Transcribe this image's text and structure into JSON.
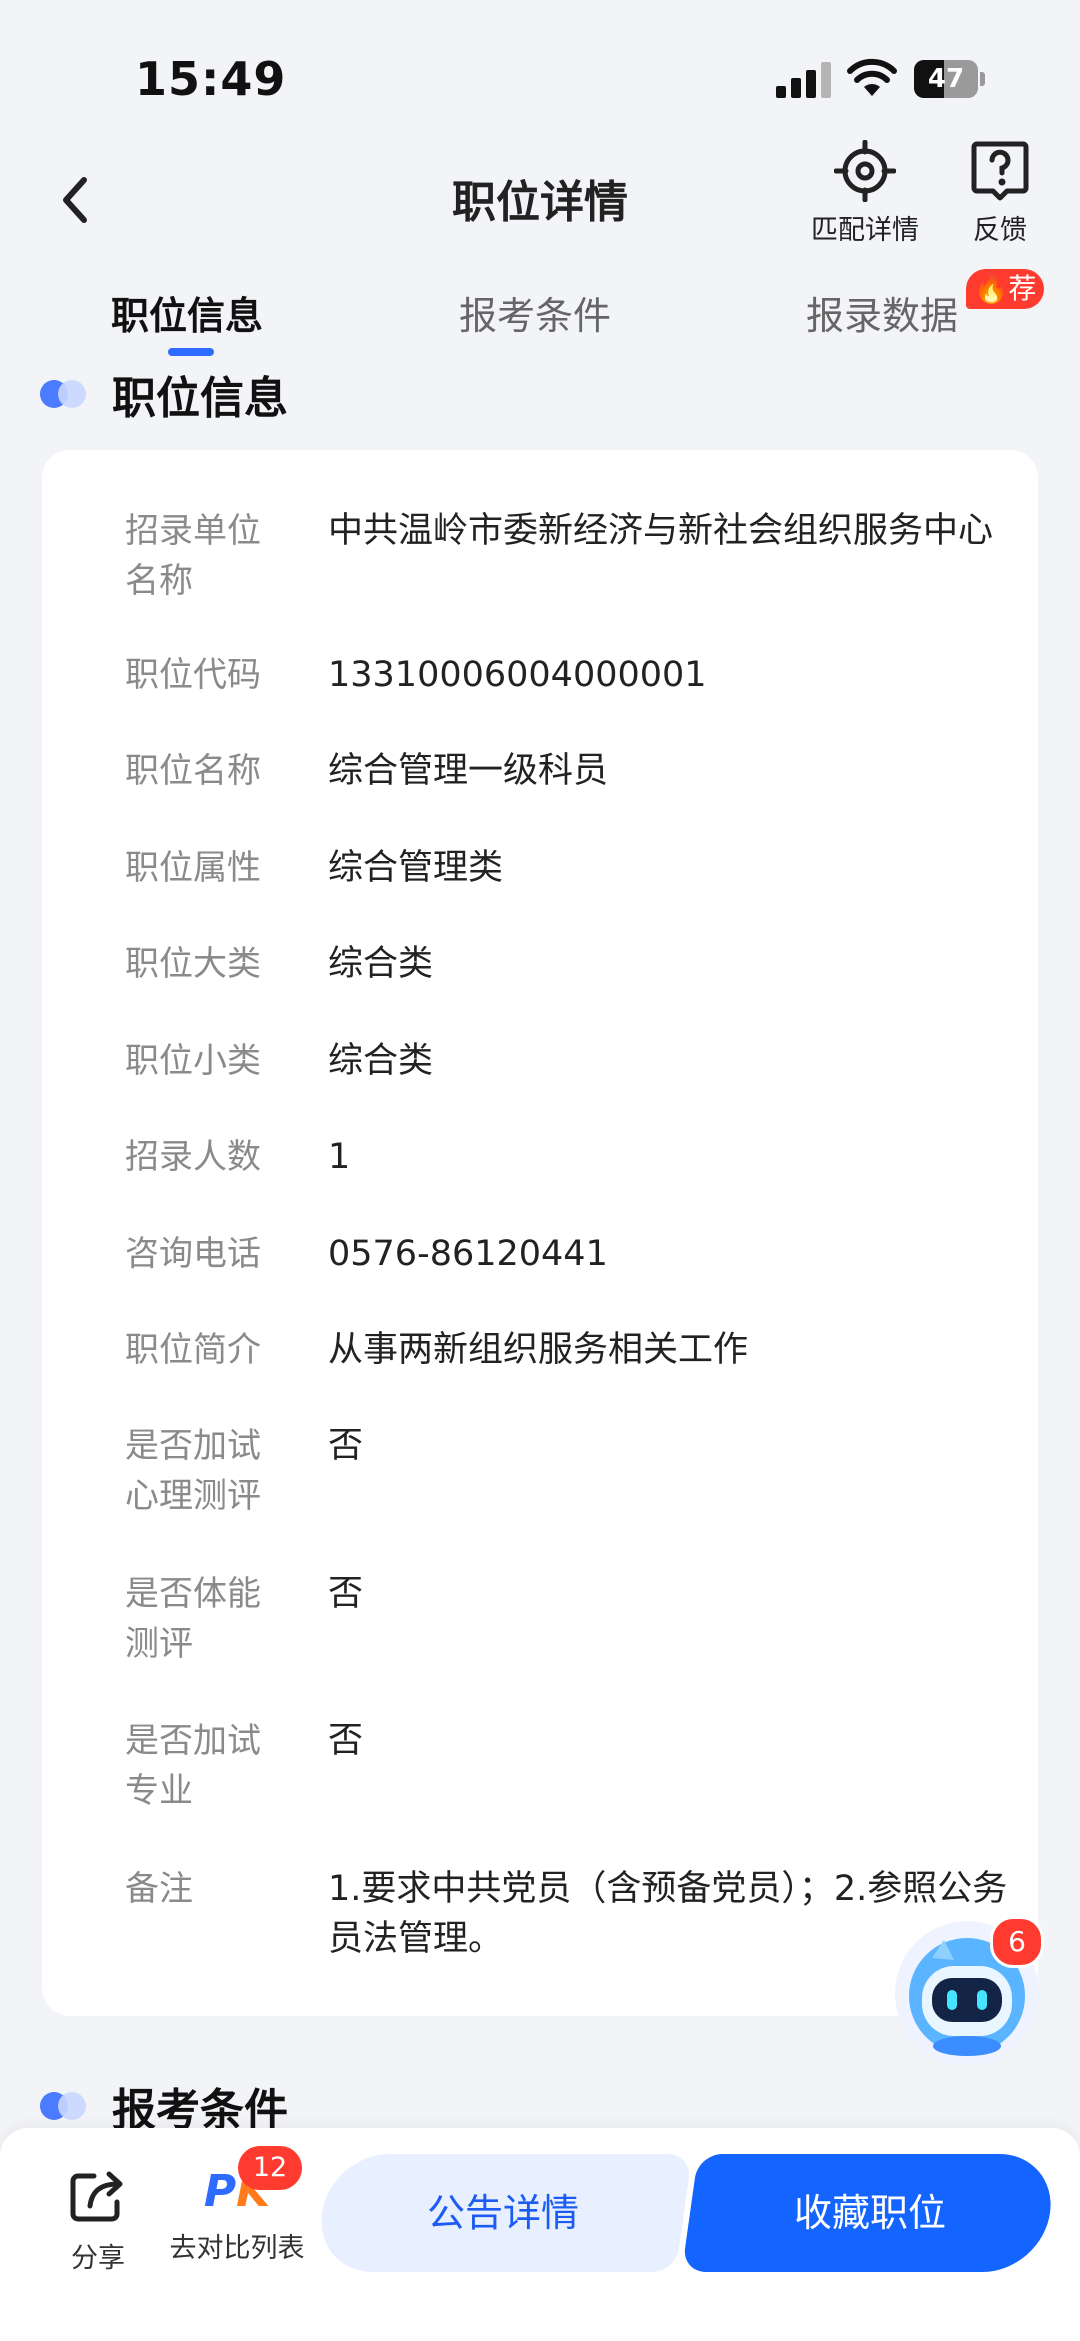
{
  "status_bar": {
    "time": "15:49",
    "battery": "47",
    "battery_level": 0.47
  },
  "nav": {
    "title": "职位详情",
    "match_label": "匹配详情",
    "feedback_label": "反馈"
  },
  "tabs": [
    {
      "label": "职位信息",
      "active": true
    },
    {
      "label": "报考条件",
      "active": false
    },
    {
      "label": "报录数据",
      "active": false
    }
  ],
  "tab_badge": "荐",
  "sections": {
    "info_title": "职位信息",
    "conditions_title": "报考条件"
  },
  "position_info": [
    {
      "key": "招录单位名称",
      "value": "中共温岭市委新经济与新社会组织服务中心"
    },
    {
      "key": "职位代码",
      "value": "13310006004000001"
    },
    {
      "key": "职位名称",
      "value": "综合管理一级科员"
    },
    {
      "key": "职位属性",
      "value": "综合管理类"
    },
    {
      "key": "职位大类",
      "value": "综合类"
    },
    {
      "key": "职位小类",
      "value": "综合类"
    },
    {
      "key": "招录人数",
      "value": "1"
    },
    {
      "key": "咨询电话",
      "value": "0576-86120441"
    },
    {
      "key": "职位简介",
      "value": "从事两新组织服务相关工作"
    },
    {
      "key": "是否加试心理测评",
      "value": "否"
    },
    {
      "key": "是否体能测评",
      "value": "否"
    },
    {
      "key": "是否加试专业",
      "value": "否"
    },
    {
      "key": "备注",
      "value": "1.要求中共党员（含预备党员）；2.参照公务员法管理。"
    }
  ],
  "assistant": {
    "badge": "6"
  },
  "bottom": {
    "share_label": "分享",
    "compare_label": "去对比列表",
    "compare_badge": "12",
    "pk_p": "P",
    "pk_k": "K",
    "notice_button": "公告详情",
    "favorite_button": "收藏职位"
  },
  "colors": {
    "primary": "#1464ff",
    "accent_red": "#ff3b30",
    "page_bg": "#f3f4f8"
  }
}
